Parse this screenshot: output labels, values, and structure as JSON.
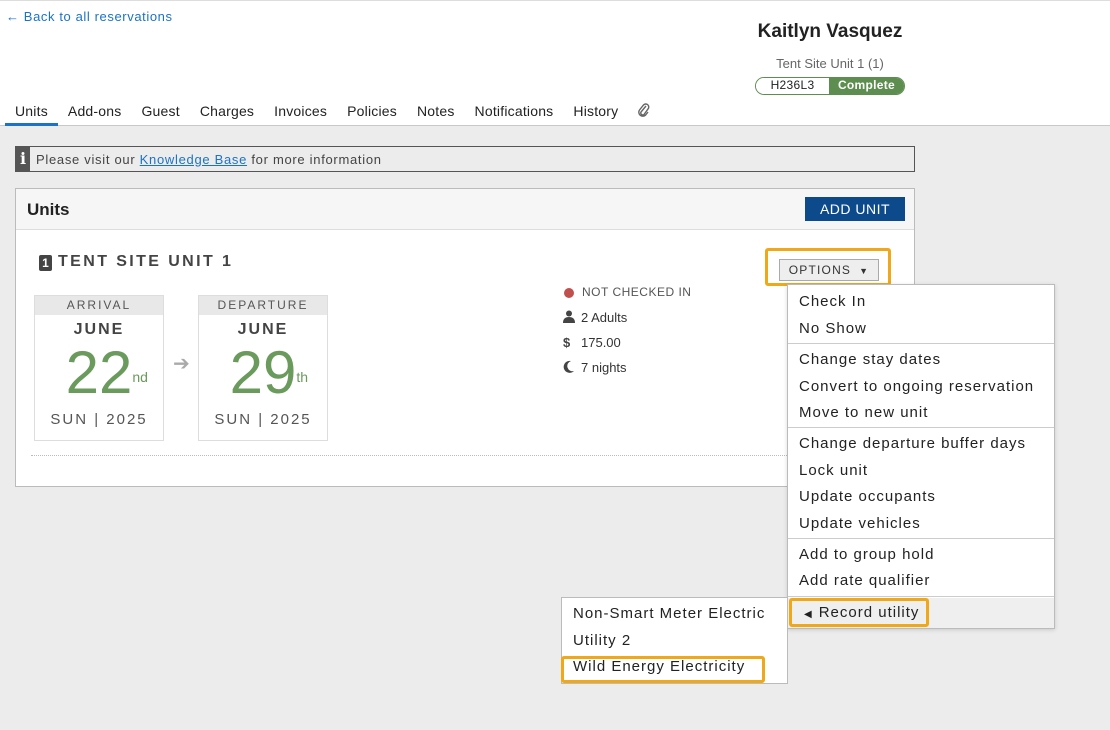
{
  "header": {
    "back_link": "← Back to all reservations",
    "guest_name": "Kaitlyn Vasquez",
    "unit_subtitle": "Tent Site Unit 1 (1)",
    "reservation_code": "H236L3",
    "status": "Complete",
    "status_color": "#5d8d4f"
  },
  "tabs": [
    {
      "label": "Units",
      "active": true
    },
    {
      "label": "Add-ons"
    },
    {
      "label": "Guest"
    },
    {
      "label": "Charges"
    },
    {
      "label": "Invoices"
    },
    {
      "label": "Policies"
    },
    {
      "label": "Notes"
    },
    {
      "label": "Notifications"
    },
    {
      "label": "History"
    }
  ],
  "tab_attachment_icon": "paperclip-icon",
  "info_bar": {
    "icon": "info-icon",
    "prefix": "Please visit our ",
    "link": "Knowledge Base",
    "suffix": " for more information"
  },
  "units_panel": {
    "title": "Units",
    "add_button": "ADD UNIT",
    "unit": {
      "number": "1",
      "name": "TENT SITE UNIT 1",
      "arrival": {
        "label": "ARRIVAL",
        "month": "JUNE",
        "day": "22",
        "suffix": "nd",
        "weekday_year": "SUN | 2025"
      },
      "departure": {
        "label": "DEPARTURE",
        "month": "JUNE",
        "day": "29",
        "suffix": "th",
        "weekday_year": "SUN | 2025"
      },
      "check_status": "NOT CHECKED IN",
      "adults": "2 Adults",
      "amount": "175.00",
      "nights": "7 nights"
    }
  },
  "options": {
    "button_label": "OPTIONS",
    "menu_items": [
      "Check In",
      "No Show",
      "Change stay dates",
      "Convert to ongoing reservation",
      "Move to new unit",
      "Change departure buffer days",
      "Lock unit",
      "Update occupants",
      "Update vehicles",
      "Add to group hold",
      "Add rate qualifier",
      "Record utility"
    ],
    "submenu_items": [
      "Non-Smart Meter Electric",
      "Utility 2",
      "Wild Energy Electricity"
    ]
  },
  "colors": {
    "accent": "#1a73c8",
    "highlight": "#f0a818",
    "primary_button": "#0d4a8c",
    "date_green": "#6a9a5c"
  }
}
